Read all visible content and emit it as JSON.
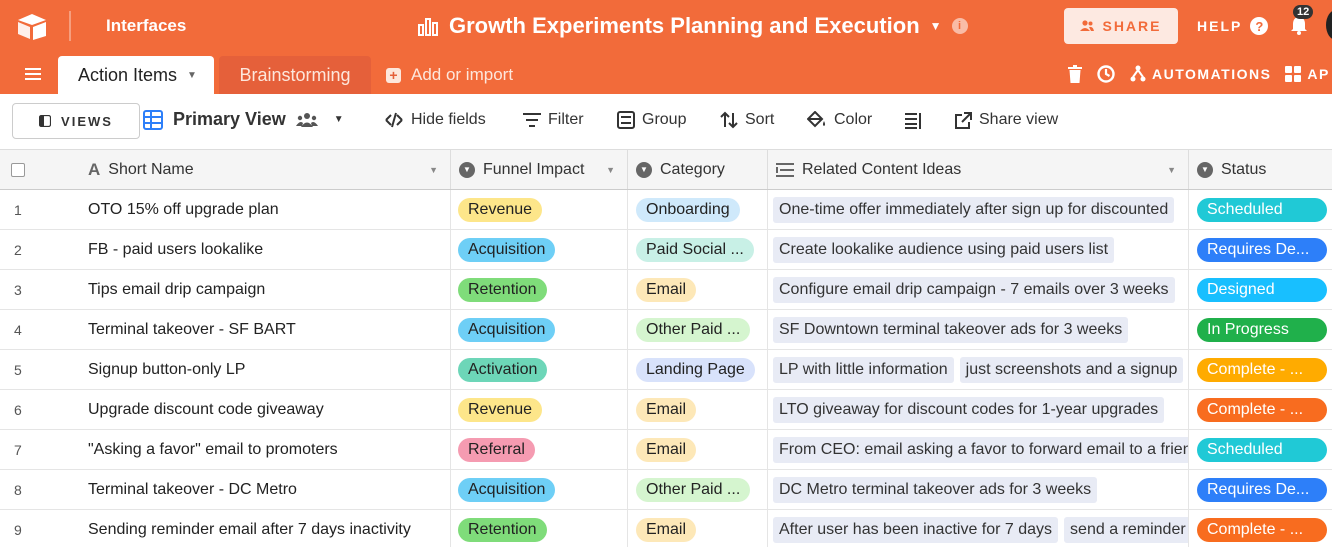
{
  "topbar": {
    "interfaces_label": "Interfaces",
    "base_title": "Growth Experiments Planning and Execution",
    "share_label": "SHARE",
    "help_label": "HELP",
    "notification_count": "12"
  },
  "tabs": {
    "active_label": "Action Items",
    "inactive_label": "Brainstorming",
    "add_import_label": "Add or import",
    "automations_label": "AUTOMATIONS",
    "apps_label_partial": "AP"
  },
  "viewbar": {
    "views_label": "VIEWS",
    "primary_view_label": "Primary View",
    "hide_fields_label": "Hide fields",
    "filter_label": "Filter",
    "group_label": "Group",
    "sort_label": "Sort",
    "color_label": "Color",
    "share_view_label": "Share view"
  },
  "columns": {
    "short_name": "Short Name",
    "funnel_impact": "Funnel Impact",
    "category": "Category",
    "related_content": "Related Content Ideas",
    "status": "Status"
  },
  "colors": {
    "brand": "#f26b3a",
    "Revenue": "#fde68a",
    "Acquisition": "#6ecff6",
    "Retention": "#7fdc7a",
    "Activation": "#6dd6b8",
    "Referral": "#f59bb1",
    "Onboarding": "#cfe9fb",
    "Paid Social ...": "#c8f0e6",
    "Email": "#fde8b8",
    "Other Paid ...": "#d5f5cf",
    "Landing Page": "#d8e2fb",
    "Scheduled": "#20c9d6",
    "Requires De...": "#2d7ff9",
    "Designed": "#18bfff",
    "In Progress": "#20b04b",
    "Complete - ...": "#ffab00",
    "Complete - ... ": "#f86c1f"
  },
  "rows": [
    {
      "num": "1",
      "name": "OTO 15% off upgrade plan",
      "funnel": "Revenue",
      "category": "Onboarding",
      "ideas": [
        "One-time offer immediately after sign up for discounted"
      ],
      "status": "Scheduled"
    },
    {
      "num": "2",
      "name": "FB - paid users lookalike",
      "funnel": "Acquisition",
      "category": "Paid Social ...",
      "ideas": [
        "Create lookalike audience using paid users list"
      ],
      "status": "Requires De..."
    },
    {
      "num": "3",
      "name": "Tips email drip campaign",
      "funnel": "Retention",
      "category": "Email",
      "ideas": [
        "Configure email drip campaign - 7 emails over 3 weeks"
      ],
      "status": "Designed"
    },
    {
      "num": "4",
      "name": "Terminal takeover - SF BART",
      "funnel": "Acquisition",
      "category": "Other Paid ...",
      "ideas": [
        "SF Downtown terminal takeover ads for 3 weeks"
      ],
      "status": "In Progress"
    },
    {
      "num": "5",
      "name": "Signup button-only LP",
      "funnel": "Activation",
      "category": "Landing Page",
      "ideas": [
        "LP with little information",
        "just screenshots and a signup"
      ],
      "status": "Complete - ..."
    },
    {
      "num": "6",
      "name": "Upgrade discount code giveaway",
      "funnel": "Revenue",
      "category": "Email",
      "ideas": [
        "LTO giveaway for discount codes for 1-year upgrades"
      ],
      "status": "Complete - ... "
    },
    {
      "num": "7",
      "name": "\"Asking a favor\" email to promoters",
      "funnel": "Referral",
      "category": "Email",
      "ideas": [
        "From CEO: email asking a favor to forward email to a friend"
      ],
      "status": "Scheduled"
    },
    {
      "num": "8",
      "name": "Terminal takeover - DC Metro",
      "funnel": "Acquisition",
      "category": "Other Paid ...",
      "ideas": [
        "DC Metro terminal takeover ads for 3 weeks"
      ],
      "status": "Requires De..."
    },
    {
      "num": "9",
      "name": "Sending reminder email after 7 days inactivity",
      "funnel": "Retention",
      "category": "Email",
      "ideas": [
        "After user has been inactive for 7 days",
        "send a reminder"
      ],
      "status": "Complete - ... "
    }
  ]
}
